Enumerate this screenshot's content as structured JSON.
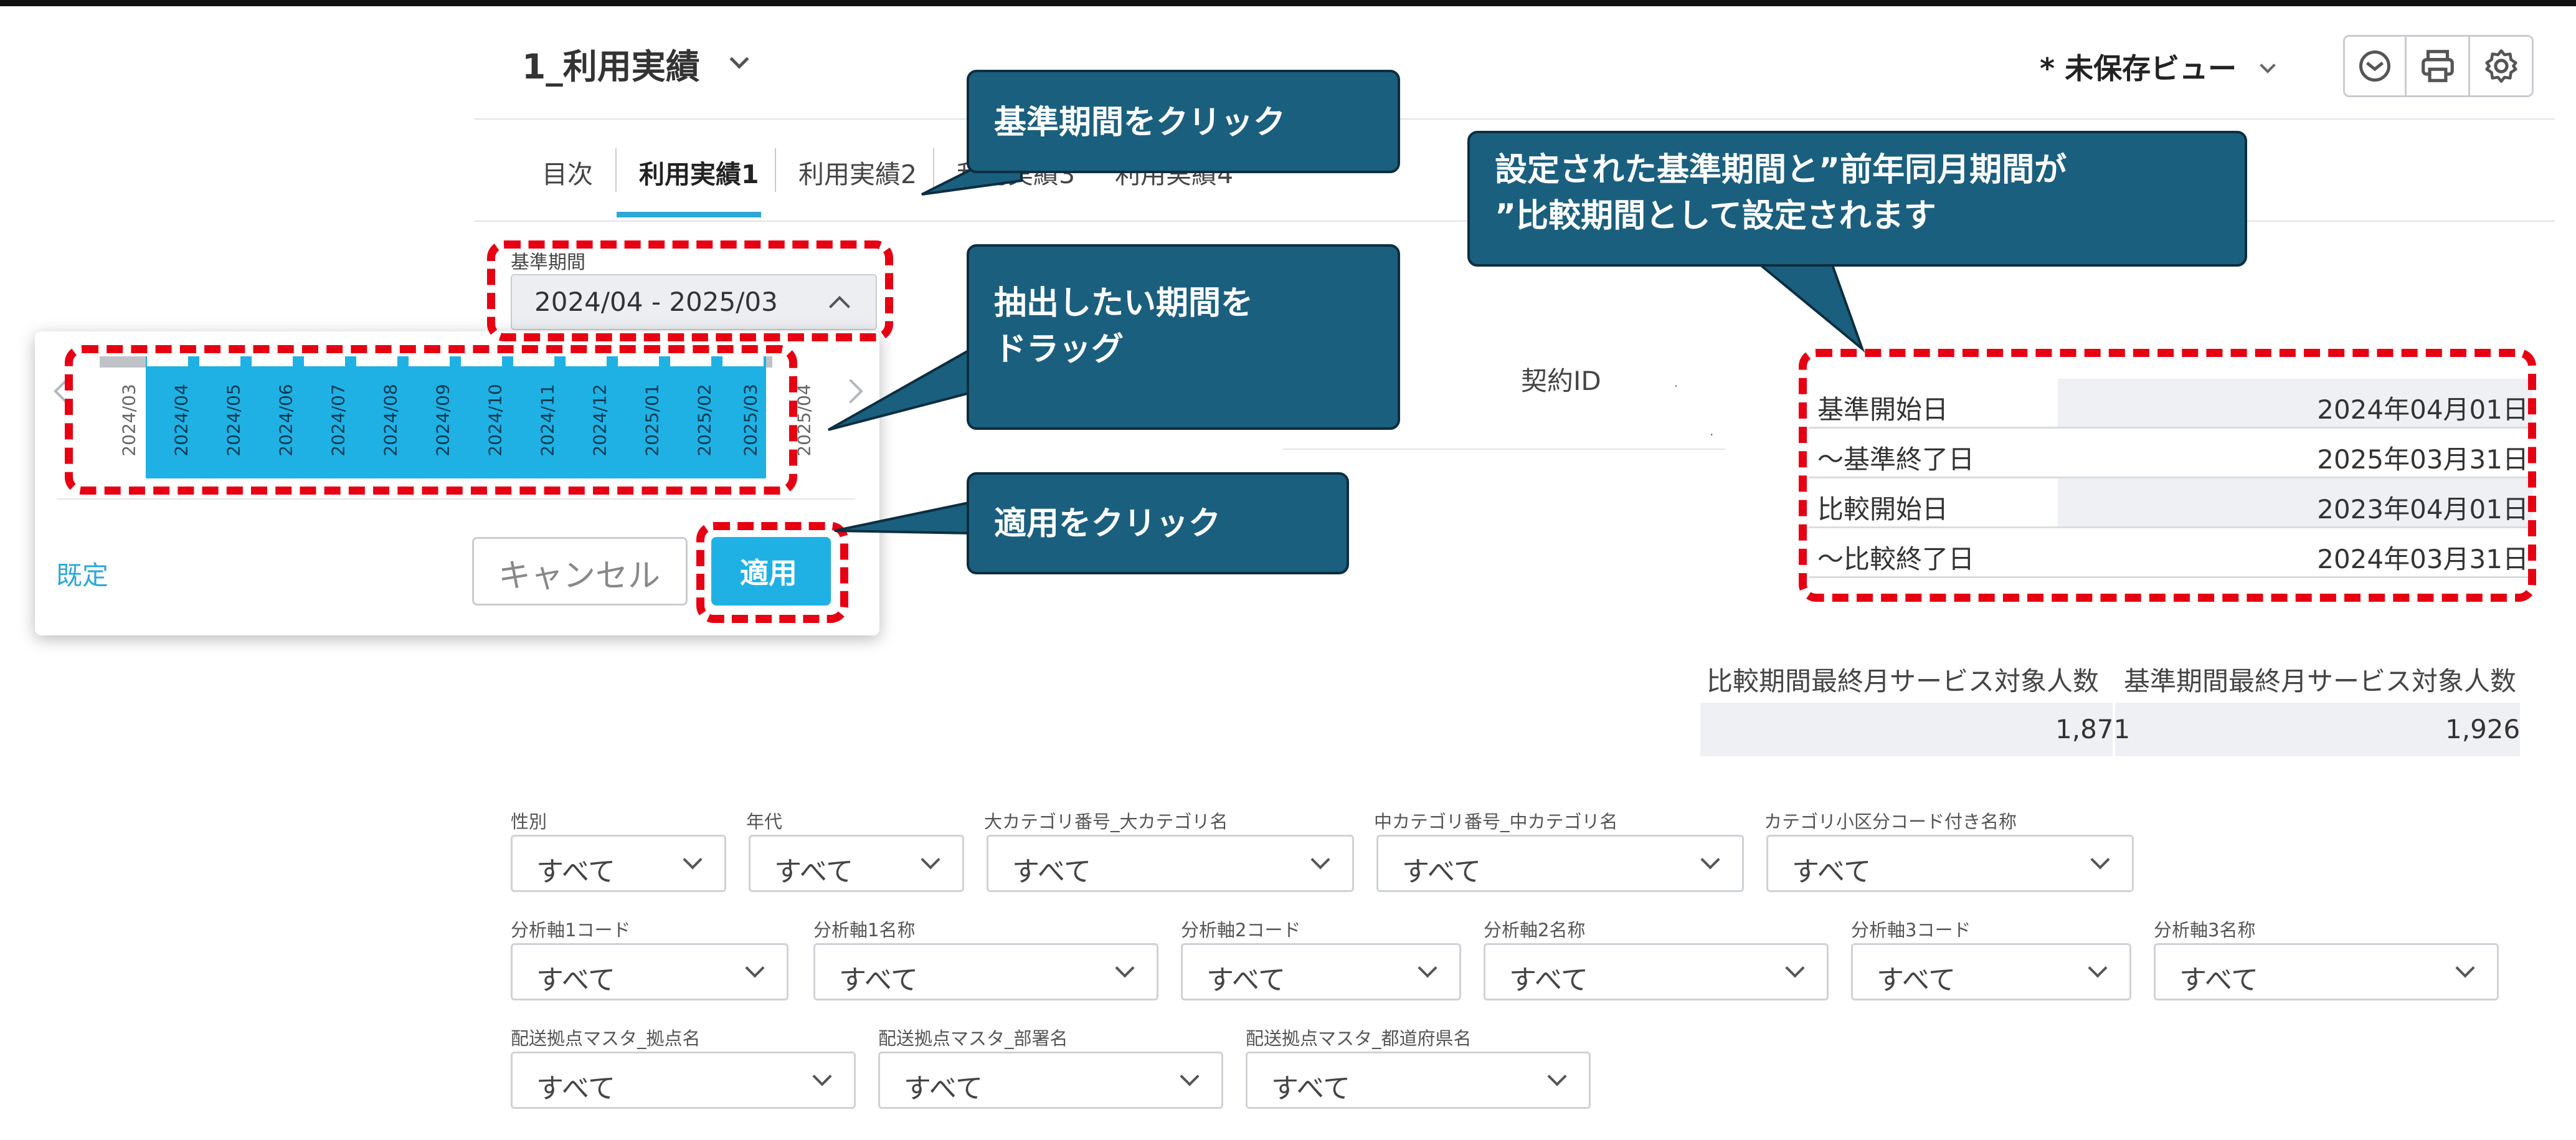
{
  "header": {
    "title": "1_利用実績",
    "view_label": "* 未保存ビュー"
  },
  "tabs": [
    {
      "label": "目次"
    },
    {
      "label": "利用実績1"
    },
    {
      "label": "利用実績2"
    },
    {
      "label": "利用実績3"
    },
    {
      "label": "利用実績4"
    }
  ],
  "period": {
    "label": "基準期間",
    "value": "2024/04 - 2025/03"
  },
  "picker": {
    "months": [
      "2024/03",
      "2024/04",
      "2024/05",
      "2024/06",
      "2024/07",
      "2024/08",
      "2024/09",
      "2024/10",
      "2024/11",
      "2024/12",
      "2025/01",
      "2025/02",
      "2025/03",
      "2025/04"
    ],
    "preset_label": "既定",
    "cancel_label": "キャンセル",
    "apply_label": "適用"
  },
  "contract": {
    "label": "契約ID"
  },
  "dates": [
    {
      "label": "基準開始日",
      "value": "2024年04月01日"
    },
    {
      "label": "～基準終了日",
      "value": "2025年03月31日"
    },
    {
      "label": "比較開始日",
      "value": "2023年04月01日"
    },
    {
      "label": "～比較終了日",
      "value": "2024年03月31日"
    }
  ],
  "counts": {
    "compare_header": "比較期間最終月サービス対象人数",
    "base_header": "基準期間最終月サービス対象人数",
    "compare_value": "1,871",
    "base_value": "1,926"
  },
  "filters": {
    "all_label": "すべて",
    "row1": [
      "性別",
      "年代",
      "大カテゴリ番号_大カテゴリ名",
      "中カテゴリ番号_中カテゴリ名",
      "カテゴリ小区分コード付き名称"
    ],
    "row2": [
      "分析軸1コード",
      "分析軸1名称",
      "分析軸2コード",
      "分析軸2名称",
      "分析軸3コード",
      "分析軸3名称"
    ],
    "row3": [
      "配送拠点マスタ_拠点名",
      "配送拠点マスタ_部署名",
      "配送拠点マスタ_都道府県名"
    ]
  },
  "callouts": {
    "click_period": "基準期間をクリック",
    "drag_period": [
      "抽出したい期間を",
      "ドラッグ"
    ],
    "click_apply": "適用をクリック",
    "note": [
      "設定された基準期間と”前年同月期間が",
      "”比較期間として設定されます"
    ]
  },
  "colors": {
    "accent": "#1fb1e4",
    "callout": "#1b5f7e",
    "highlight": "#e60012"
  }
}
